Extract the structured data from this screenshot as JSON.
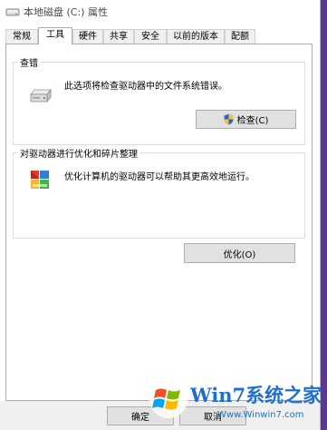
{
  "window": {
    "title": "本地磁盘 (C:) 属性"
  },
  "tabs": [
    {
      "label": "常规"
    },
    {
      "label": "工具"
    },
    {
      "label": "硬件"
    },
    {
      "label": "共享"
    },
    {
      "label": "安全"
    },
    {
      "label": "以前的版本"
    },
    {
      "label": "配额"
    }
  ],
  "active_tab": "工具",
  "error_checking": {
    "title": "查错",
    "description": "此选项将检查驱动器中的文件系统错误。",
    "button_label": "检查(C)",
    "icon": "drive-icon"
  },
  "optimize": {
    "title": "对驱动器进行优化和碎片整理",
    "description": "优化计算机的驱动器可以帮助其更高效地运行。",
    "button_label": "优化(O)",
    "icon": "defrag-icon"
  },
  "footer": {
    "ok_label": "确定",
    "cancel_label": "取消"
  },
  "watermark": {
    "brand": "Win7系统之家",
    "url": "Www.Winwin7.com"
  }
}
